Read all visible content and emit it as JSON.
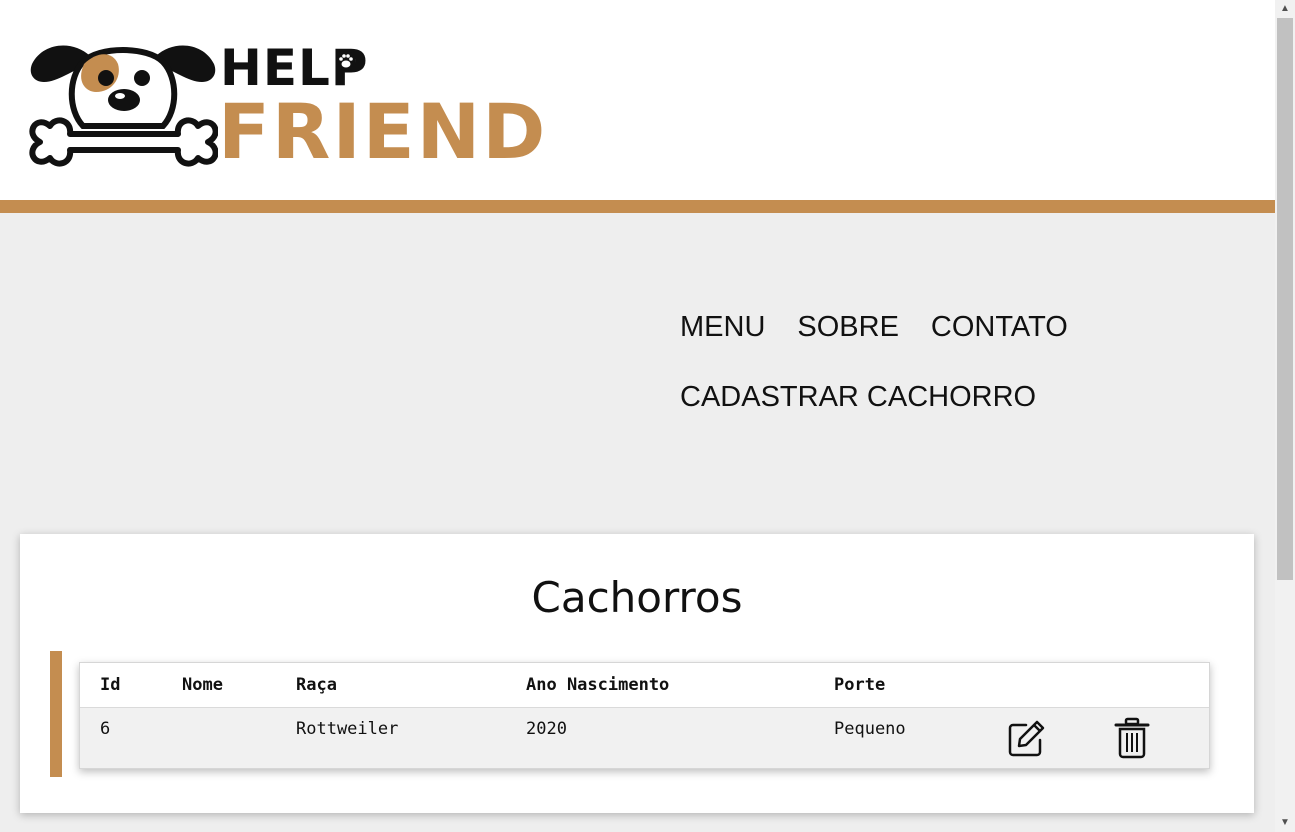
{
  "brand": {
    "line1": "HELP",
    "line2": "FRIEND",
    "accent_color": "#c48d50"
  },
  "nav": {
    "items": [
      "MENU",
      "SOBRE",
      "CONTATO"
    ],
    "register": "CADASTRAR CACHORRO"
  },
  "section": {
    "title": "Cachorros"
  },
  "table": {
    "headers": [
      "Id",
      "Nome",
      "Raça",
      "Ano Nascimento",
      "Porte"
    ],
    "rows": [
      {
        "id": "6",
        "nome": "",
        "raca": "Rottweiler",
        "ano": "2020",
        "porte": "Pequeno"
      }
    ]
  },
  "icons": {
    "edit": "edit-icon",
    "delete": "trash-icon",
    "logo": "dog-bone-logo",
    "paw": "paw-icon"
  }
}
